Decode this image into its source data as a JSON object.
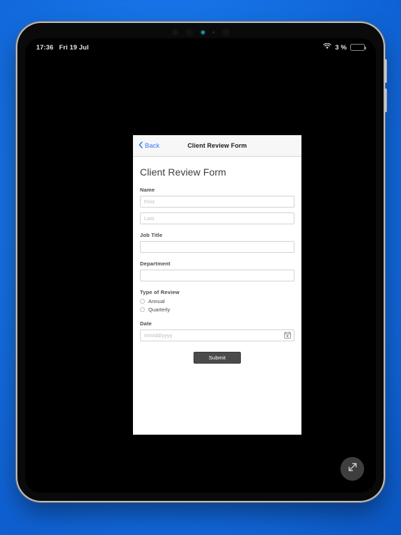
{
  "status_bar": {
    "time": "17:36",
    "date": "Fri 19 Jul",
    "wifi_icon": "wifi-icon",
    "battery_percent": "3 %",
    "battery_icon": "battery-low-icon",
    "battery_level": 3
  },
  "nav": {
    "back_label": "Back",
    "back_icon": "chevron-left-icon",
    "title": "Client Review Form"
  },
  "form": {
    "heading": "Client Review Form",
    "name": {
      "label": "Name",
      "first_placeholder": "First",
      "first_value": "",
      "last_placeholder": "Last",
      "last_value": ""
    },
    "job_title": {
      "label": "Job Title",
      "placeholder": "",
      "value": ""
    },
    "department": {
      "label": "Department",
      "placeholder": "",
      "value": ""
    },
    "type_of_review": {
      "label": "Type of Review",
      "options": [
        {
          "label": "Annual",
          "selected": false
        },
        {
          "label": "Quarterly",
          "selected": false
        }
      ]
    },
    "date": {
      "label": "Date",
      "placeholder": "mm/dd/yyyy",
      "value": "",
      "picker_icon": "calendar-icon"
    },
    "submit_label": "Submit"
  },
  "floating": {
    "resize_icon": "resize-diagonal-icon"
  },
  "colors": {
    "background_blue": "#1673e6",
    "link_blue": "#2f7cf6",
    "submit_gray": "#4b4b4b",
    "battery_red": "#e03a2f",
    "camera_teal": "#1c8ea6"
  }
}
